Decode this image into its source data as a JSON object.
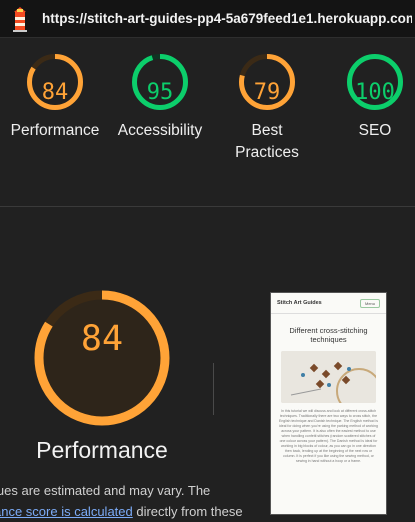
{
  "header": {
    "url": "https://stitch-art-guides-pp4-5a679feed1e1.herokuapp.com/...",
    "logo_icon": "lighthouse-icon"
  },
  "categories": [
    {
      "label": "Performance",
      "score": "84",
      "value": 84,
      "color": "#ffa337"
    },
    {
      "label": "Accessibility",
      "score": "95",
      "value": 95,
      "color": "#0cce6b"
    },
    {
      "label": "Best Practices",
      "score": "79",
      "value": 79,
      "color": "#ffa337"
    },
    {
      "label": "SEO",
      "score": "100",
      "value": 100,
      "color": "#0cce6b"
    }
  ],
  "detail": {
    "score": "84",
    "value": 84,
    "title": "Performance",
    "desc_line1": "lues are estimated and may vary. The",
    "desc_link": "ance score is calculated",
    "desc_rest": " directly from these"
  },
  "screenshot": {
    "brand": "Stitch Art Guides",
    "menu": "Menu",
    "heading": "Different cross-stitching techniques",
    "body": "In this tutorial we will discuss and look at different cross-stitch techniques. Traditionally there are two ways to cross stitch, the English technique and Danish technique. The English method is ideal for doing when you're using the parking method of working across your pattern. It is also often the easiest method to use when handling confetti stitches (random scattered stitches of one colour across your pattern). The Danish method is ideal for working in big blocks of colour, as you can go in one direction then back, lending up at the beginning of the next row or column. It is perfect if you like using the sewing method, or sewing in hand without a hoop or a frame."
  },
  "colors": {
    "average": "#ffa337",
    "pass": "#0cce6b",
    "background": "#212121"
  }
}
